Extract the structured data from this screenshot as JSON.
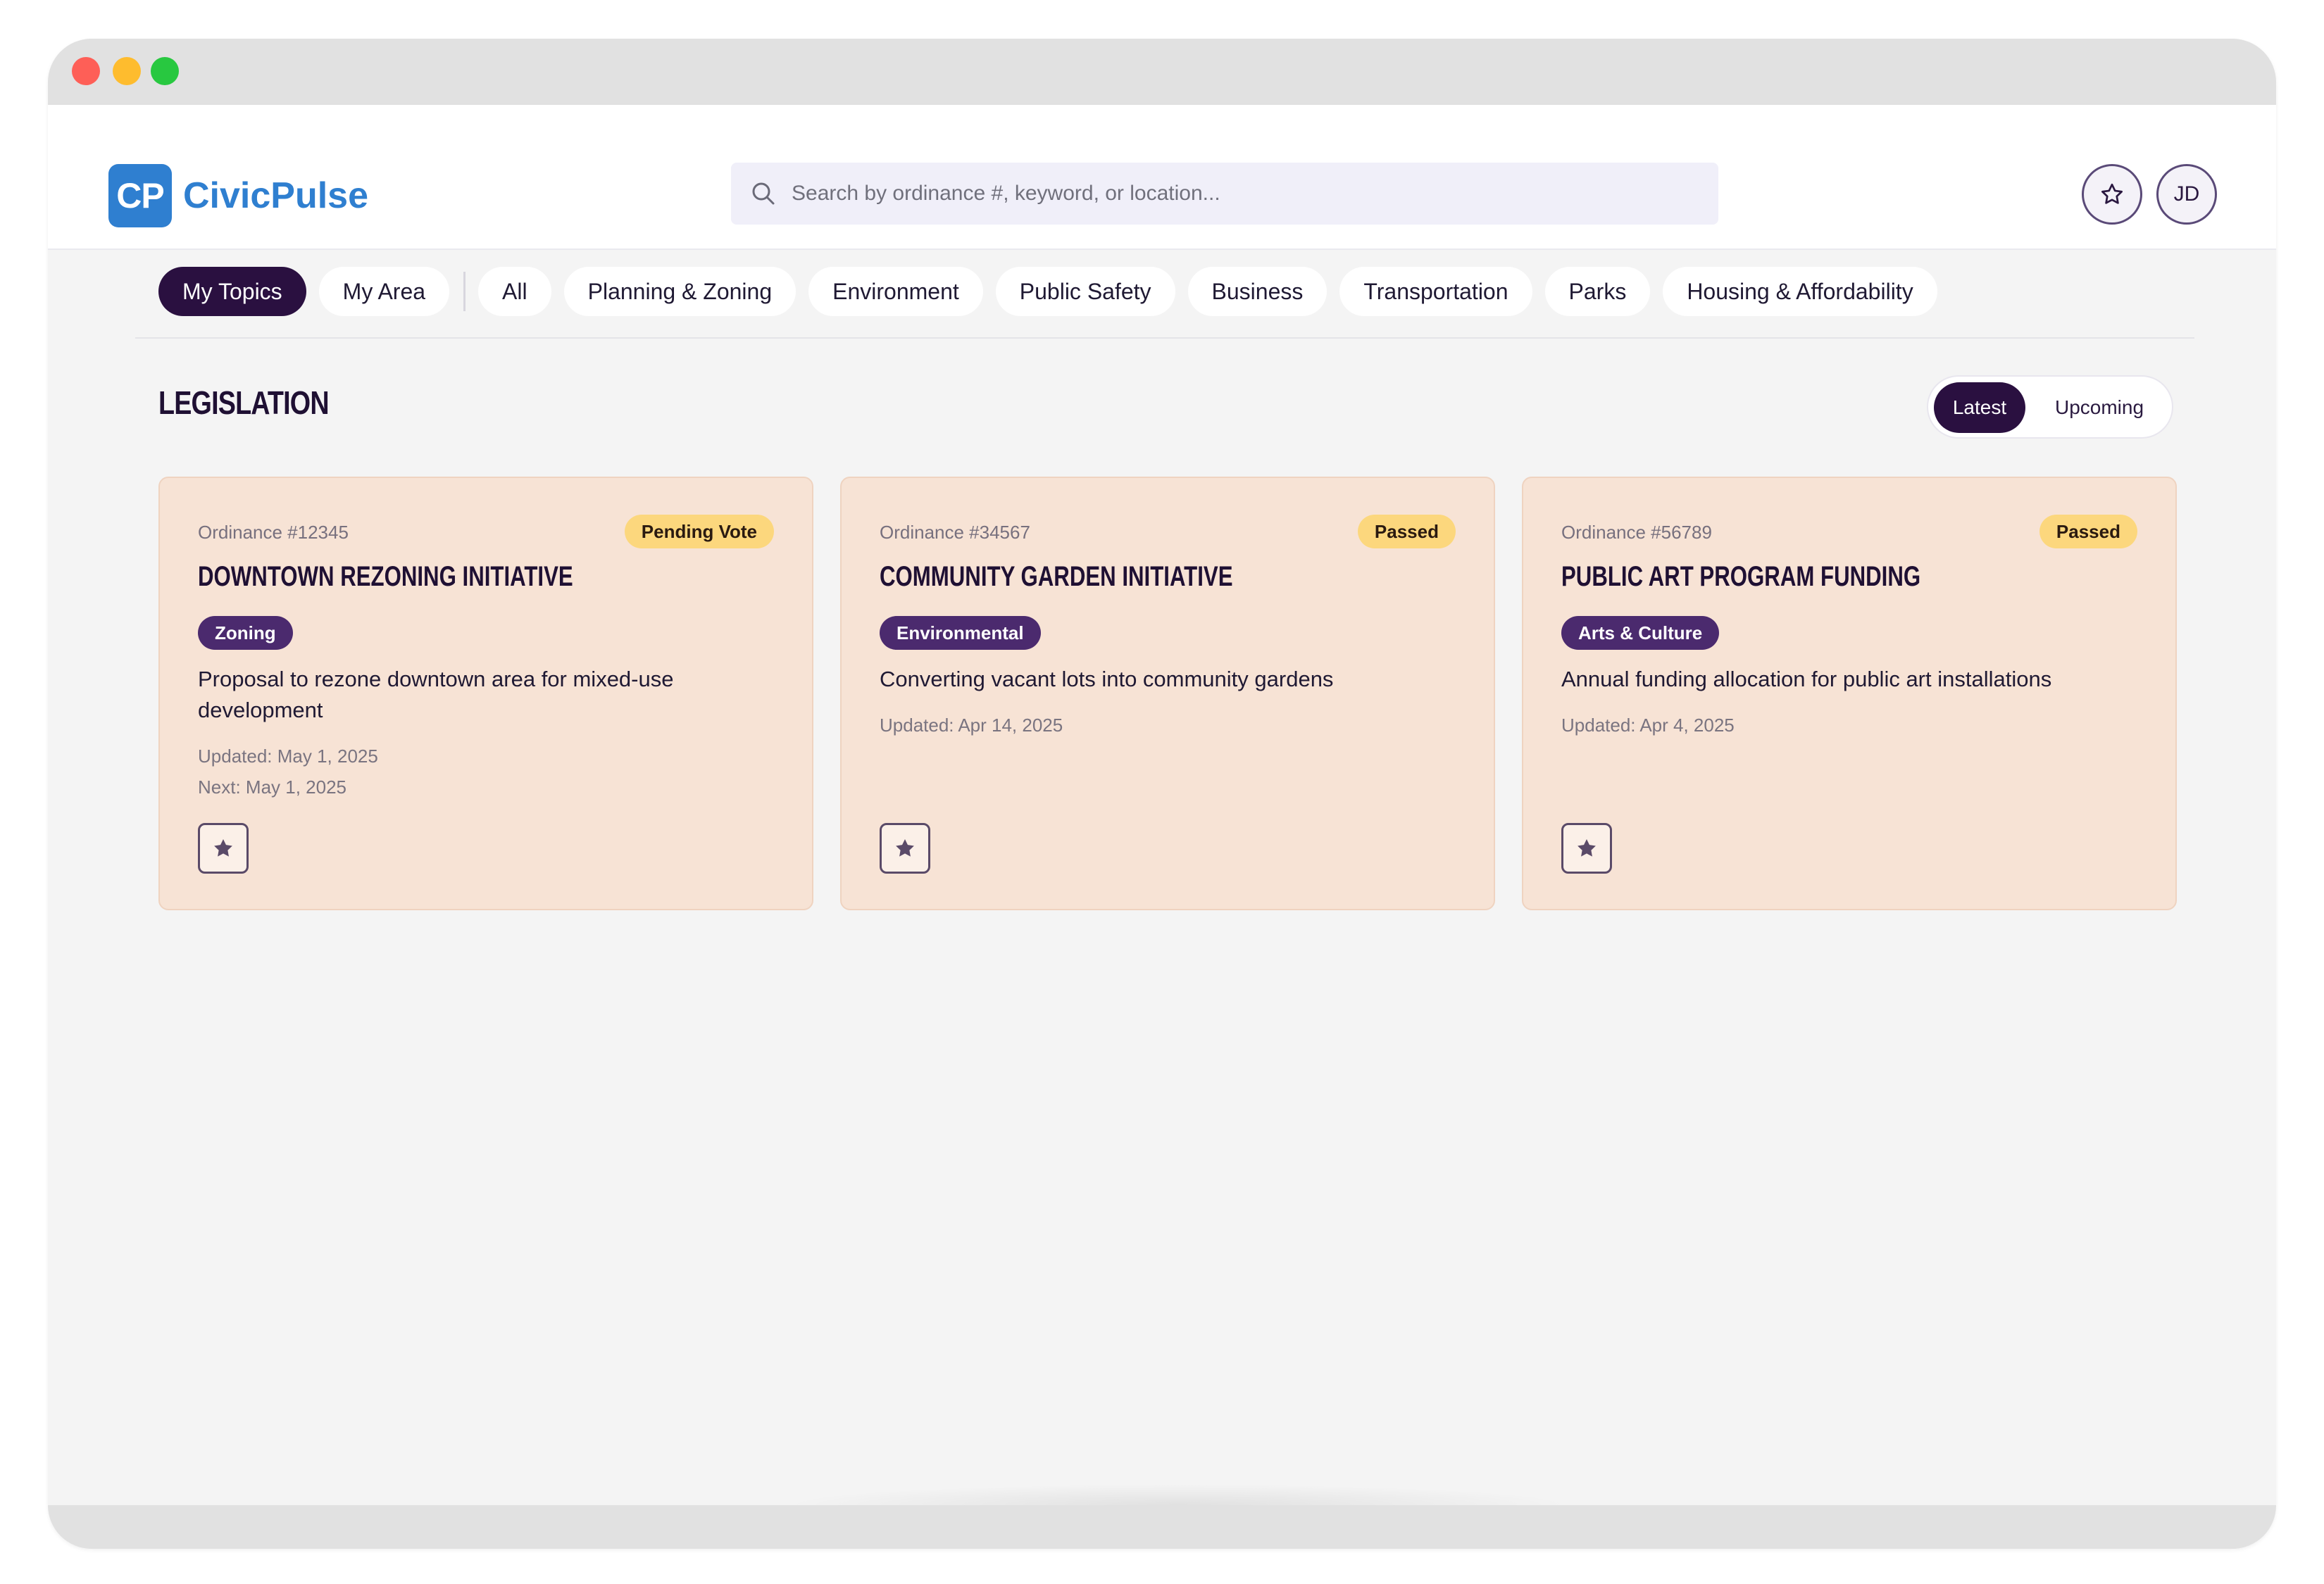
{
  "window": {
    "controls": [
      "close",
      "minimize",
      "zoom"
    ]
  },
  "header": {
    "logo_badge": "CP",
    "logo_text": "CivicPulse",
    "search_placeholder": "Search by ordinance #, keyword, or location...",
    "favorites_icon": "star-outline-icon",
    "avatar_initials": "JD"
  },
  "tabs": {
    "personal": [
      {
        "label": "My Topics",
        "active": true
      },
      {
        "label": "My Area",
        "active": false
      }
    ],
    "categories": [
      {
        "label": "All"
      },
      {
        "label": "Planning & Zoning"
      },
      {
        "label": "Environment"
      },
      {
        "label": "Public Safety"
      },
      {
        "label": "Business"
      },
      {
        "label": "Transportation"
      },
      {
        "label": "Parks"
      },
      {
        "label": "Housing & Affordability"
      }
    ]
  },
  "section": {
    "title": "Legislation",
    "toggle": {
      "latest": "Latest",
      "upcoming": "Upcoming",
      "selected": "Latest"
    }
  },
  "cards": [
    {
      "number": "Ordinance #12345",
      "status": "Pending Vote",
      "title": "Downtown Rezoning Initiative",
      "tag": "Zoning",
      "description": "Proposal to rezone downtown area for mixed-use development",
      "updated": "Updated: May 1, 2025",
      "next": "Next: May 1, 2025"
    },
    {
      "number": "Ordinance #34567",
      "status": "Passed",
      "title": "Community Garden Initiative",
      "tag": "Environmental",
      "description": "Converting vacant lots into community gardens",
      "updated": "Updated: Apr 14, 2025",
      "next": ""
    },
    {
      "number": "Ordinance #56789",
      "status": "Passed",
      "title": "Public Art Program Funding",
      "tag": "Arts & Culture",
      "description": "Annual funding allocation for public art installations",
      "updated": "Updated: Apr 4, 2025",
      "next": ""
    }
  ],
  "colors": {
    "brand": "#2f7fd0",
    "primary_dark": "#2a1040",
    "tag_purple": "#4b2a6e",
    "card_bg": "#f7e3d5",
    "status_yellow": "#fcd77d"
  }
}
